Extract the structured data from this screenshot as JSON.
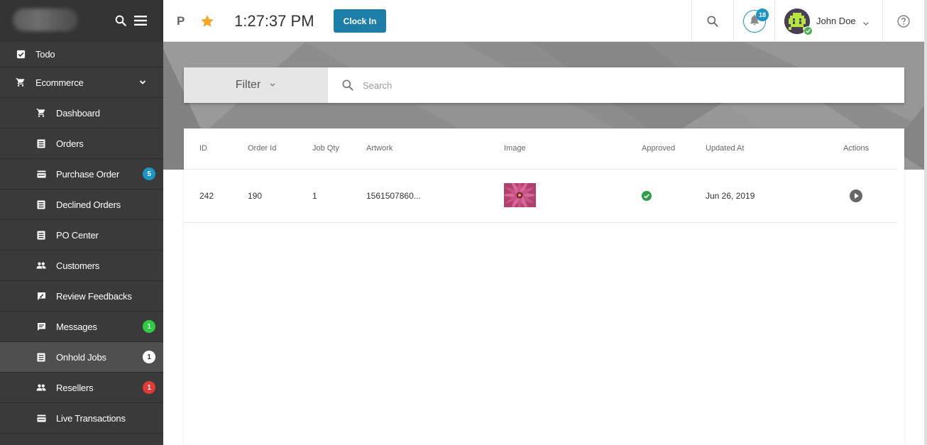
{
  "sidebar": {
    "items": [
      {
        "label": "Todo",
        "icon": "checkbox-icon",
        "level": 0
      },
      {
        "label": "Ecommerce",
        "icon": "cart-icon",
        "level": 0,
        "expanded": true
      },
      {
        "label": "Dashboard",
        "icon": "cart-icon",
        "level": 1
      },
      {
        "label": "Orders",
        "icon": "list-icon",
        "level": 1
      },
      {
        "label": "Purchase Order",
        "icon": "card-icon",
        "level": 1,
        "badge": "5",
        "badge_color": "#1a95c4"
      },
      {
        "label": "Declined Orders",
        "icon": "list-icon",
        "level": 1
      },
      {
        "label": "PO Center",
        "icon": "list-icon",
        "level": 1
      },
      {
        "label": "Customers",
        "icon": "people-icon",
        "level": 1
      },
      {
        "label": "Review Feedbacks",
        "icon": "feedback-icon",
        "level": 1
      },
      {
        "label": "Messages",
        "icon": "message-icon",
        "level": 1,
        "badge": "1",
        "badge_color": "#2ecc40"
      },
      {
        "label": "Onhold Jobs",
        "icon": "list-icon",
        "level": 1,
        "badge": "1",
        "badge_color": "#ffffff",
        "active": true
      },
      {
        "label": "Resellers",
        "icon": "people-icon",
        "level": 1,
        "badge": "1",
        "badge_color": "#e53935"
      },
      {
        "label": "Live Transactions",
        "icon": "card-icon",
        "level": 1
      }
    ]
  },
  "header": {
    "p_label": "P",
    "time": "1:27:37 PM",
    "clock_in_label": "Clock In",
    "notification_count": "18",
    "user_name": "John Doe"
  },
  "filter": {
    "label": "Filter",
    "search_placeholder": "Search"
  },
  "table": {
    "columns": [
      "ID",
      "Order Id",
      "Job Qty",
      "Artwork",
      "Image",
      "Approved",
      "Updated At",
      "Actions"
    ],
    "rows": [
      {
        "id": "242",
        "order_id": "190",
        "job_qty": "1",
        "artwork": "1561507860...",
        "approved": true,
        "updated_at": "Jun 26, 2019"
      }
    ]
  },
  "colors": {
    "sidebar_bg": "#3a3a3a",
    "accent": "#1d7fa7",
    "star": "#f5a623",
    "approved": "#2e9e46"
  }
}
